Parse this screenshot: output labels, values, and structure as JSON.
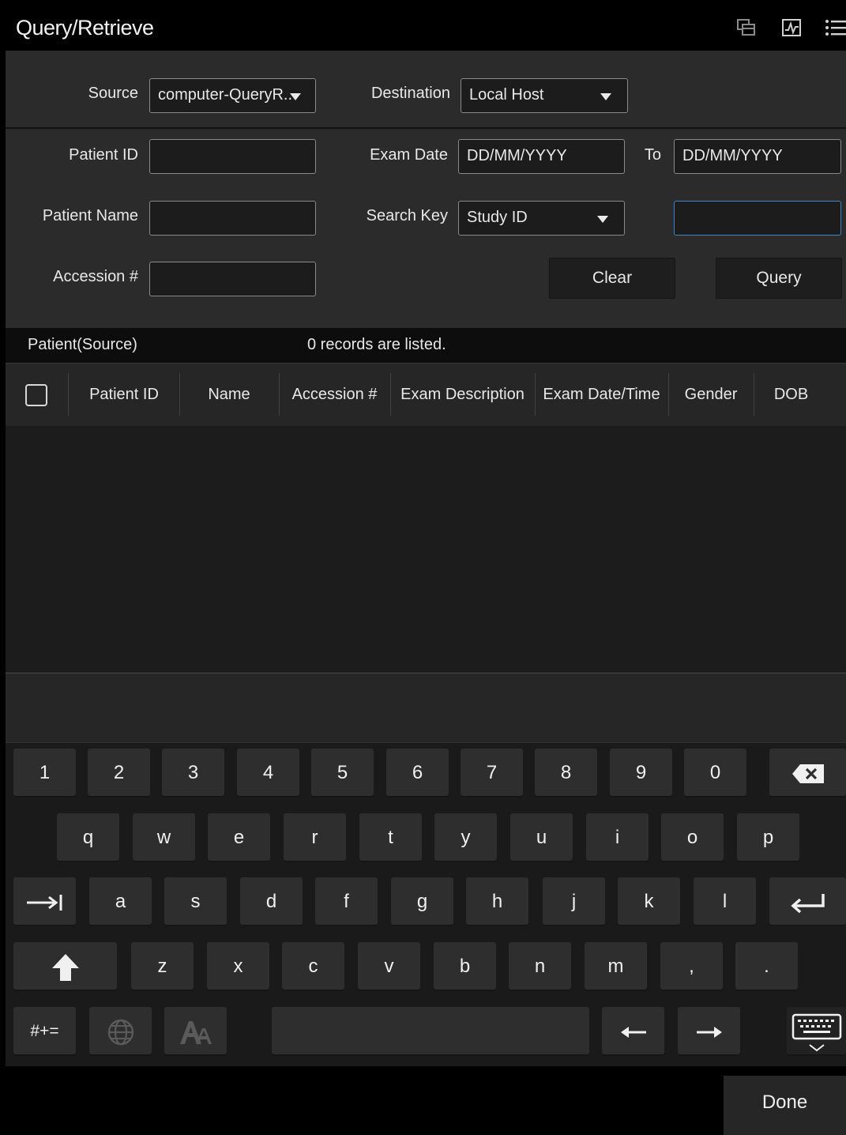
{
  "window": {
    "title": "Query/Retrieve"
  },
  "title_icons": [
    "window-copy-icon",
    "waveform-icon",
    "menu-list-icon"
  ],
  "form": {
    "source_label": "Source",
    "source_value": "computer-QueryR..",
    "destination_label": "Destination",
    "destination_value": "Local Host",
    "patient_id_label": "Patient ID",
    "patient_id_value": "",
    "exam_date_label": "Exam Date",
    "exam_date_from_placeholder": "DD/MM/YYYY",
    "to_label": "To",
    "exam_date_to_placeholder": "DD/MM/YYYY",
    "patient_name_label": "Patient Name",
    "patient_name_value": "",
    "search_key_label": "Search Key",
    "search_key_value": "Study ID",
    "search_key_input_value": "",
    "accession_label": "Accession #",
    "accession_value": "",
    "clear_label": "Clear",
    "query_label": "Query"
  },
  "status": {
    "section_label": "Patient(Source)",
    "records_text": "0 records are listed."
  },
  "table": {
    "columns": [
      "Patient ID",
      "Name",
      "Accession #",
      "Exam Description",
      "Exam Date/Time",
      "Gender",
      "DOB"
    ],
    "rows": []
  },
  "keyboard": {
    "row1": [
      "1",
      "2",
      "3",
      "4",
      "5",
      "6",
      "7",
      "8",
      "9",
      "0"
    ],
    "row2": [
      "q",
      "w",
      "e",
      "r",
      "t",
      "y",
      "u",
      "i",
      "o",
      "p"
    ],
    "row3": [
      "a",
      "s",
      "d",
      "f",
      "g",
      "h",
      "j",
      "k",
      "l"
    ],
    "row4": [
      "z",
      "x",
      "c",
      "v",
      "b",
      "n",
      "m",
      ",",
      "."
    ],
    "symbols_label": "#+="
  },
  "footer": {
    "done_label": "Done"
  },
  "colors": {
    "accent_focus": "#3f83c8",
    "panel": "#2b2b2b",
    "background": "#000000"
  }
}
